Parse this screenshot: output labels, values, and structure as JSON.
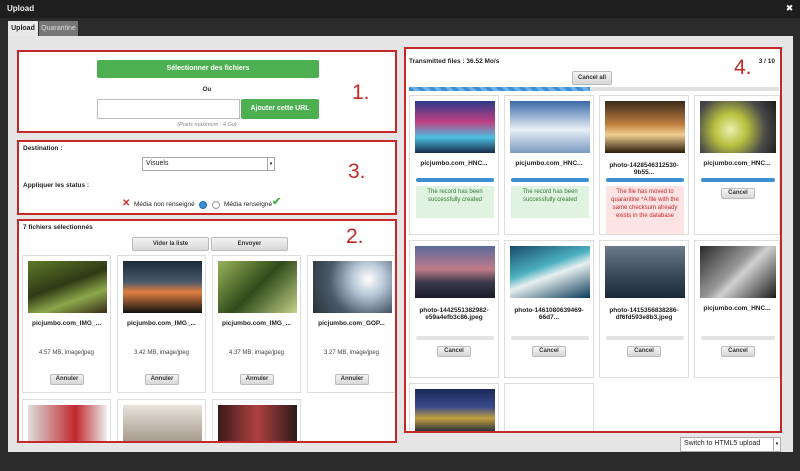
{
  "window": {
    "title": "Upload"
  },
  "tabs": [
    "Upload",
    "Quarantine"
  ],
  "annotations": [
    "1.",
    "2.",
    "3.",
    "4."
  ],
  "section1": {
    "select_files_label": "Sélectionner des fichiers",
    "or_label": "Ou",
    "url_value": "",
    "add_url_label": "Ajouter cette URL",
    "max_weight": "(Poids maximum : 4 Go)"
  },
  "section3": {
    "destination_label": "Destination :",
    "destination_value": "Visuels",
    "status_label": "Appliquer les status :",
    "status_uninformed": "Média non renseigné",
    "status_informed": "Média renseigné"
  },
  "section2": {
    "selected_count": "7 fichiers sélectionnés",
    "clear_list": "Vider la liste",
    "send": "Envoyer",
    "cancel_label": "Annuler",
    "files": [
      {
        "name": "picjumbo.com_IMG_...",
        "meta": "4.57 MB, image/jpeg"
      },
      {
        "name": "picjumbo.com_IMG_...",
        "meta": "3.42 MB, image/jpeg"
      },
      {
        "name": "picjumbo.com_IMG_...",
        "meta": "4.37 MB, image/jpeg"
      },
      {
        "name": "picjumbo.com_GOP...",
        "meta": "3.27 MB, image/jpeg"
      }
    ]
  },
  "section4": {
    "transmitted": "Transmitted files : 36.52 Mo/s",
    "counter": "3 / 10",
    "cancel_all": "Cancel all",
    "cancel_label": "Cancel",
    "progress": 0.49,
    "files": [
      {
        "name": "picjumbo.com_HNC...",
        "status": "The record has been successfully created"
      },
      {
        "name": "picjumbo.com_HNC...",
        "status": "The record has been successfully created"
      },
      {
        "name": "photo-1428546312530-9b55...",
        "status": "The file has moved to quarantine *A file with the same checksum already exists in the database"
      },
      {
        "name": "picjumbo.com_HNC...",
        "status": ""
      },
      {
        "name": "photo-1442551382982-e59a4efb3c86.jpeg",
        "status": ""
      },
      {
        "name": "photo-1461080639469-66d7...",
        "status": ""
      },
      {
        "name": "photo-1415356838286-df6fd593e8b3.jpeg",
        "status": ""
      },
      {
        "name": "picjumbo.com_HNC...",
        "status": ""
      }
    ]
  },
  "footer": {
    "mode_select": "Switch to HTML5 upload"
  }
}
